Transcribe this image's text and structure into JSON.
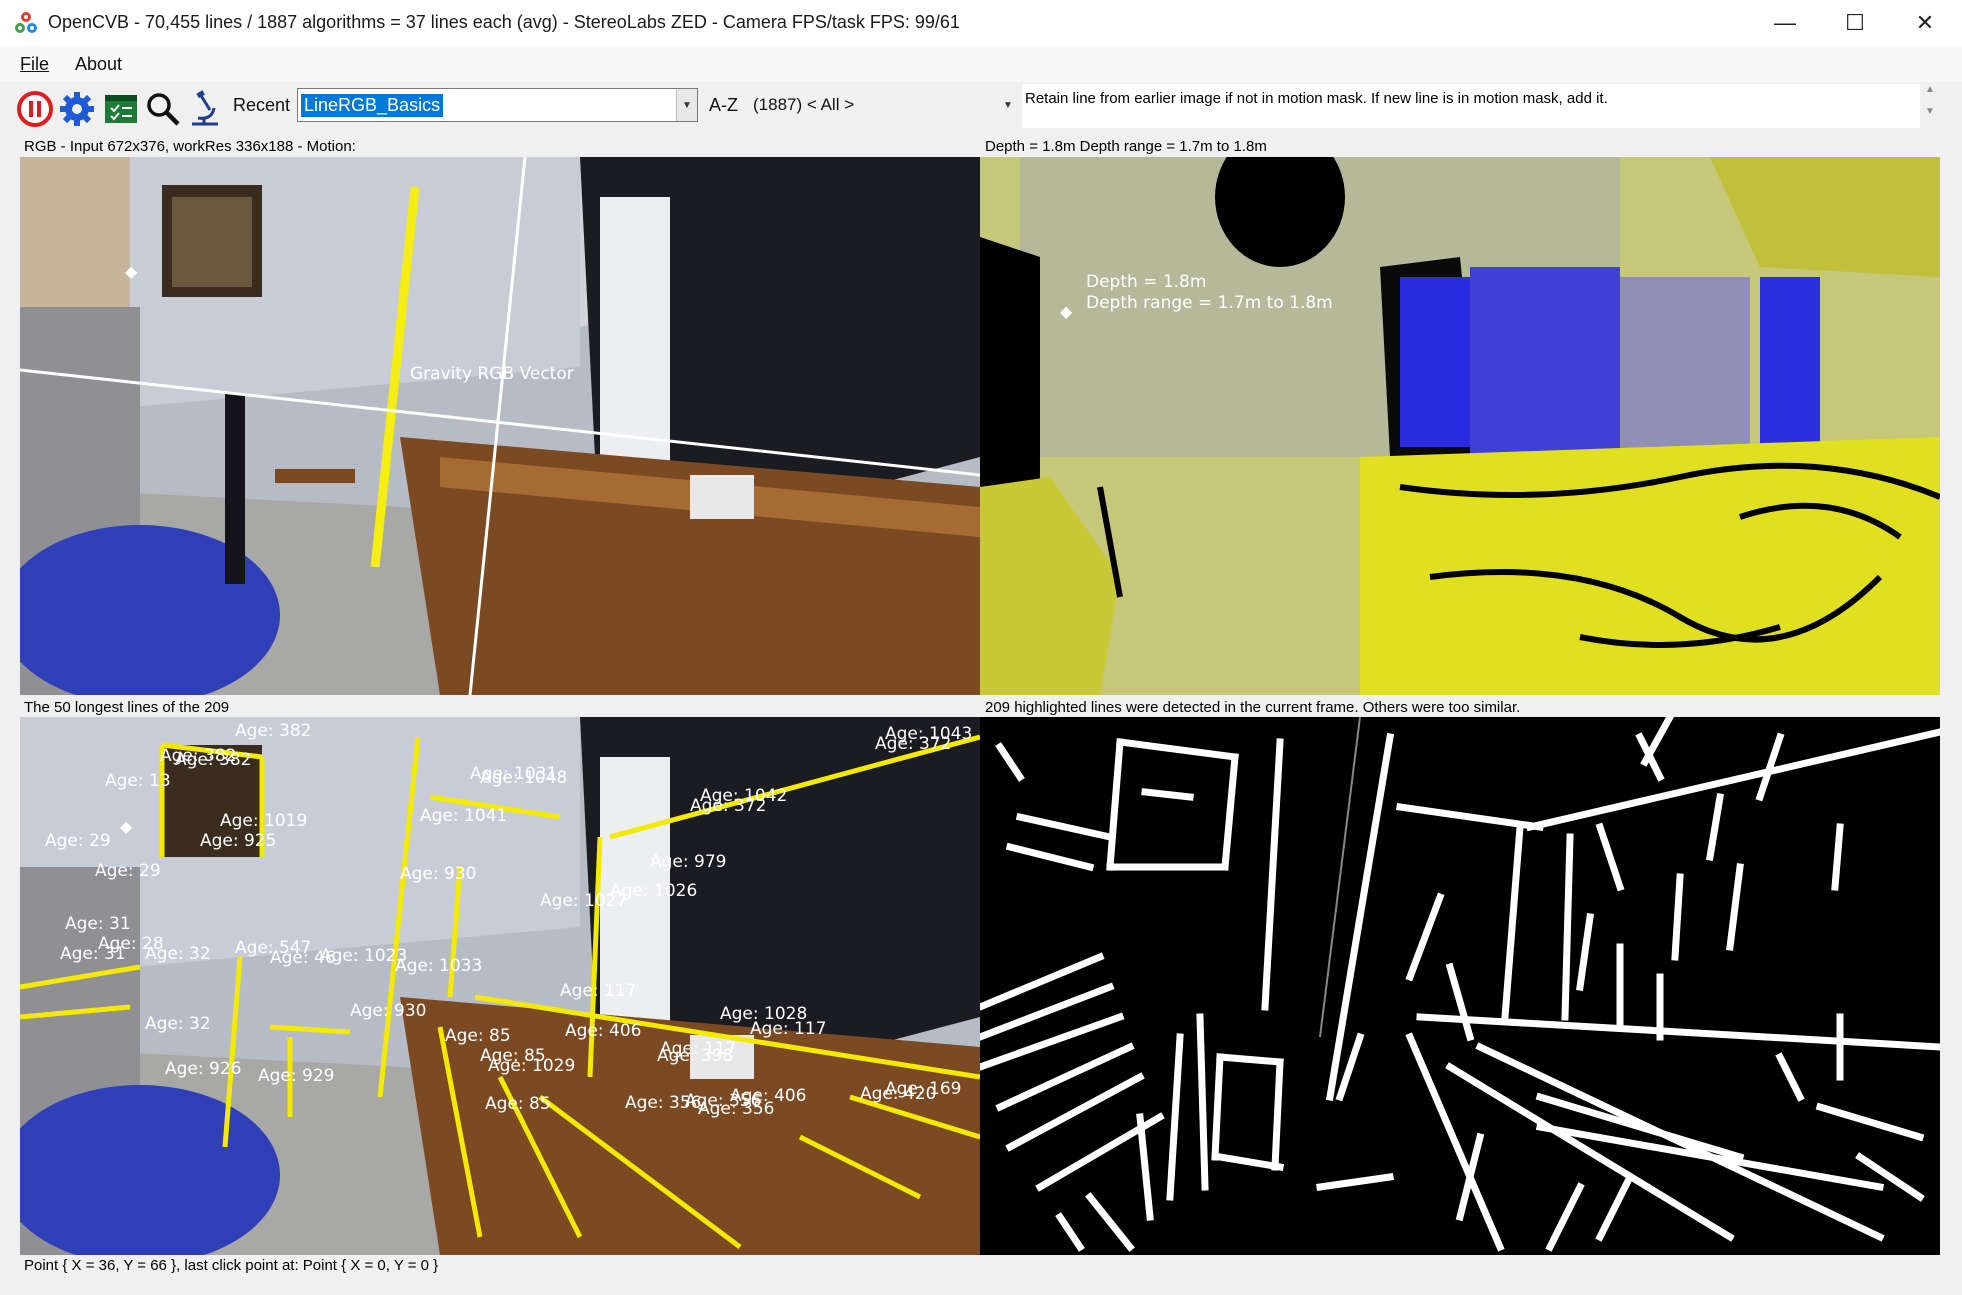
{
  "window": {
    "title": "OpenCVB - 70,455 lines / 1887 algorithms = 37 lines each (avg) - StereoLabs ZED - Camera FPS/task FPS: 99/61",
    "minimize": "—",
    "maximize": "☐",
    "close": "✕"
  },
  "menu": {
    "file": "File",
    "about": "About"
  },
  "toolbar": {
    "recent_label": "Recent",
    "algorithm": "LineRGB_Basics",
    "az_label": "A-Z",
    "group_filter": "(1887) < All >",
    "description": "Retain line from earlier image if not in motion mask.  If new line is in motion mask, add it."
  },
  "panes": {
    "top_left": {
      "caption": "RGB - Input 672x376, workRes 336x188 - Motion:",
      "overlay": "Gravity RGB Vector"
    },
    "top_right": {
      "caption": "Depth = 1.8m Depth range = 1.7m to 1.8m",
      "overlay_line1": "Depth = 1.8m",
      "overlay_line2": "Depth range = 1.7m to 1.8m"
    },
    "bottom_left": {
      "caption": "The 50 longest lines of the 209",
      "ages": [
        "Age: 1043",
        "Age: 372",
        "Age: 1031",
        "Age: 1048",
        "Age: 382",
        "Age: 382",
        "Age: 382",
        "Age: 13",
        "Age: 1042",
        "Age: 372",
        "Age: 1041",
        "Age: 1019",
        "Age: 925",
        "Age: 29",
        "Age: 29",
        "Age: 930",
        "Age: 979",
        "Age: 1026",
        "Age: 1027",
        "Age: 31",
        "Age: 28",
        "Age: 31",
        "Age: 32",
        "Age: 547",
        "Age: 46",
        "Age: 1023",
        "Age: 1033",
        "Age: 117",
        "Age: 930",
        "Age: 1028",
        "Age: 117",
        "Age: 32",
        "Age: 85",
        "Age: 406",
        "Age: 117",
        "Age: 398",
        "Age: 85",
        "Age: 1029",
        "Age: 926",
        "Age: 929",
        "Age: 85",
        "Age: 356",
        "Age: 356",
        "Age: 356",
        "Age: 406",
        "Age: 169",
        "Age: 420"
      ]
    },
    "bottom_right": {
      "caption": "209 highlighted lines were detected in the current frame. Others were too similar."
    }
  },
  "status": "Point { X = 36, Y = 66 }, last click point at: Point { X = 0, Y = 0 }"
}
